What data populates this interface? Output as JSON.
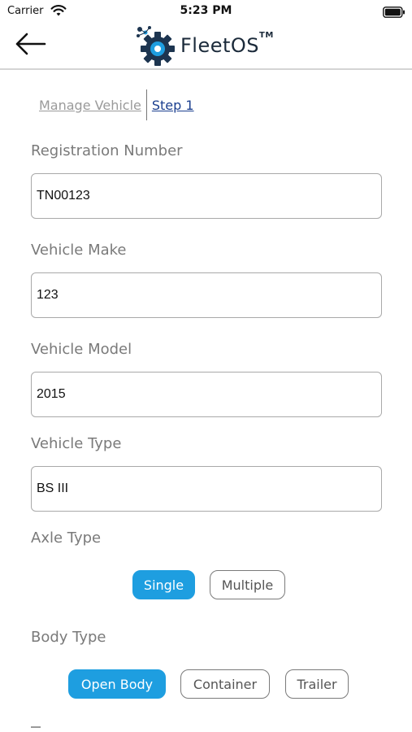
{
  "status_bar": {
    "carrier": "Carrier",
    "time": "5:23 PM"
  },
  "header": {
    "logo_text": "FleetOS",
    "logo_tm": "TM"
  },
  "breadcrumb": {
    "parent": "Manage Vehicle",
    "current": "Step 1"
  },
  "form": {
    "registration": {
      "label": "Registration Number",
      "value": "TN00123"
    },
    "make": {
      "label": "Vehicle Make",
      "value": "123"
    },
    "model": {
      "label": "Vehicle Model",
      "value": "2015"
    },
    "type": {
      "label": "Vehicle Type",
      "value": "BS III"
    },
    "axle": {
      "label": "Axle Type",
      "options": [
        "Single",
        "Multiple"
      ],
      "selected": "Single"
    },
    "body": {
      "label": "Body Type",
      "options": [
        "Open Body",
        "Container",
        "Trailer"
      ],
      "selected": "Open Body"
    }
  },
  "colors": {
    "accent": "#1e9ee0",
    "link": "#1b3f8f",
    "label": "#7a7a7a"
  },
  "icons": {
    "back": "arrow-left-icon",
    "wifi": "wifi-icon",
    "battery": "battery-icon",
    "logo": "gear-logo-icon"
  }
}
